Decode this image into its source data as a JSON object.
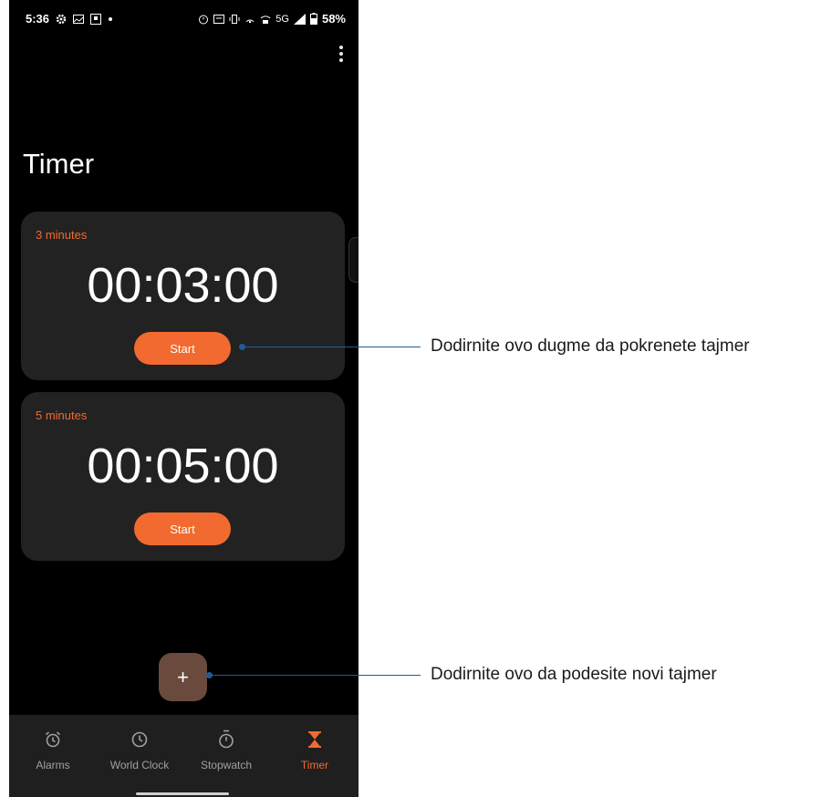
{
  "status_bar": {
    "time": "5:36",
    "battery": "58%",
    "network": "5G"
  },
  "screen": {
    "title": "Timer"
  },
  "timers": [
    {
      "label": "3 minutes",
      "time": "00:03:00",
      "button": "Start"
    },
    {
      "label": "5 minutes",
      "time": "00:05:00",
      "button": "Start"
    }
  ],
  "fab": {
    "symbol": "+",
    "icon": "plus-icon"
  },
  "nav": {
    "items": [
      {
        "label": "Alarms",
        "icon": "alarm-clock-icon"
      },
      {
        "label": "World Clock",
        "icon": "clock-icon"
      },
      {
        "label": "Stopwatch",
        "icon": "stopwatch-icon"
      },
      {
        "label": "Timer",
        "icon": "hourglass-icon"
      }
    ],
    "active_index": 3
  },
  "annotations": [
    {
      "text": "Dodirnite ovo dugme da pokrenete tajmer"
    },
    {
      "text": "Dodirnite ovo da podesite novi tajmer"
    }
  ],
  "colors": {
    "accent": "#f26a2f",
    "card": "#222222",
    "fab": "#6a4a3c",
    "callout": "#1d5d97"
  }
}
